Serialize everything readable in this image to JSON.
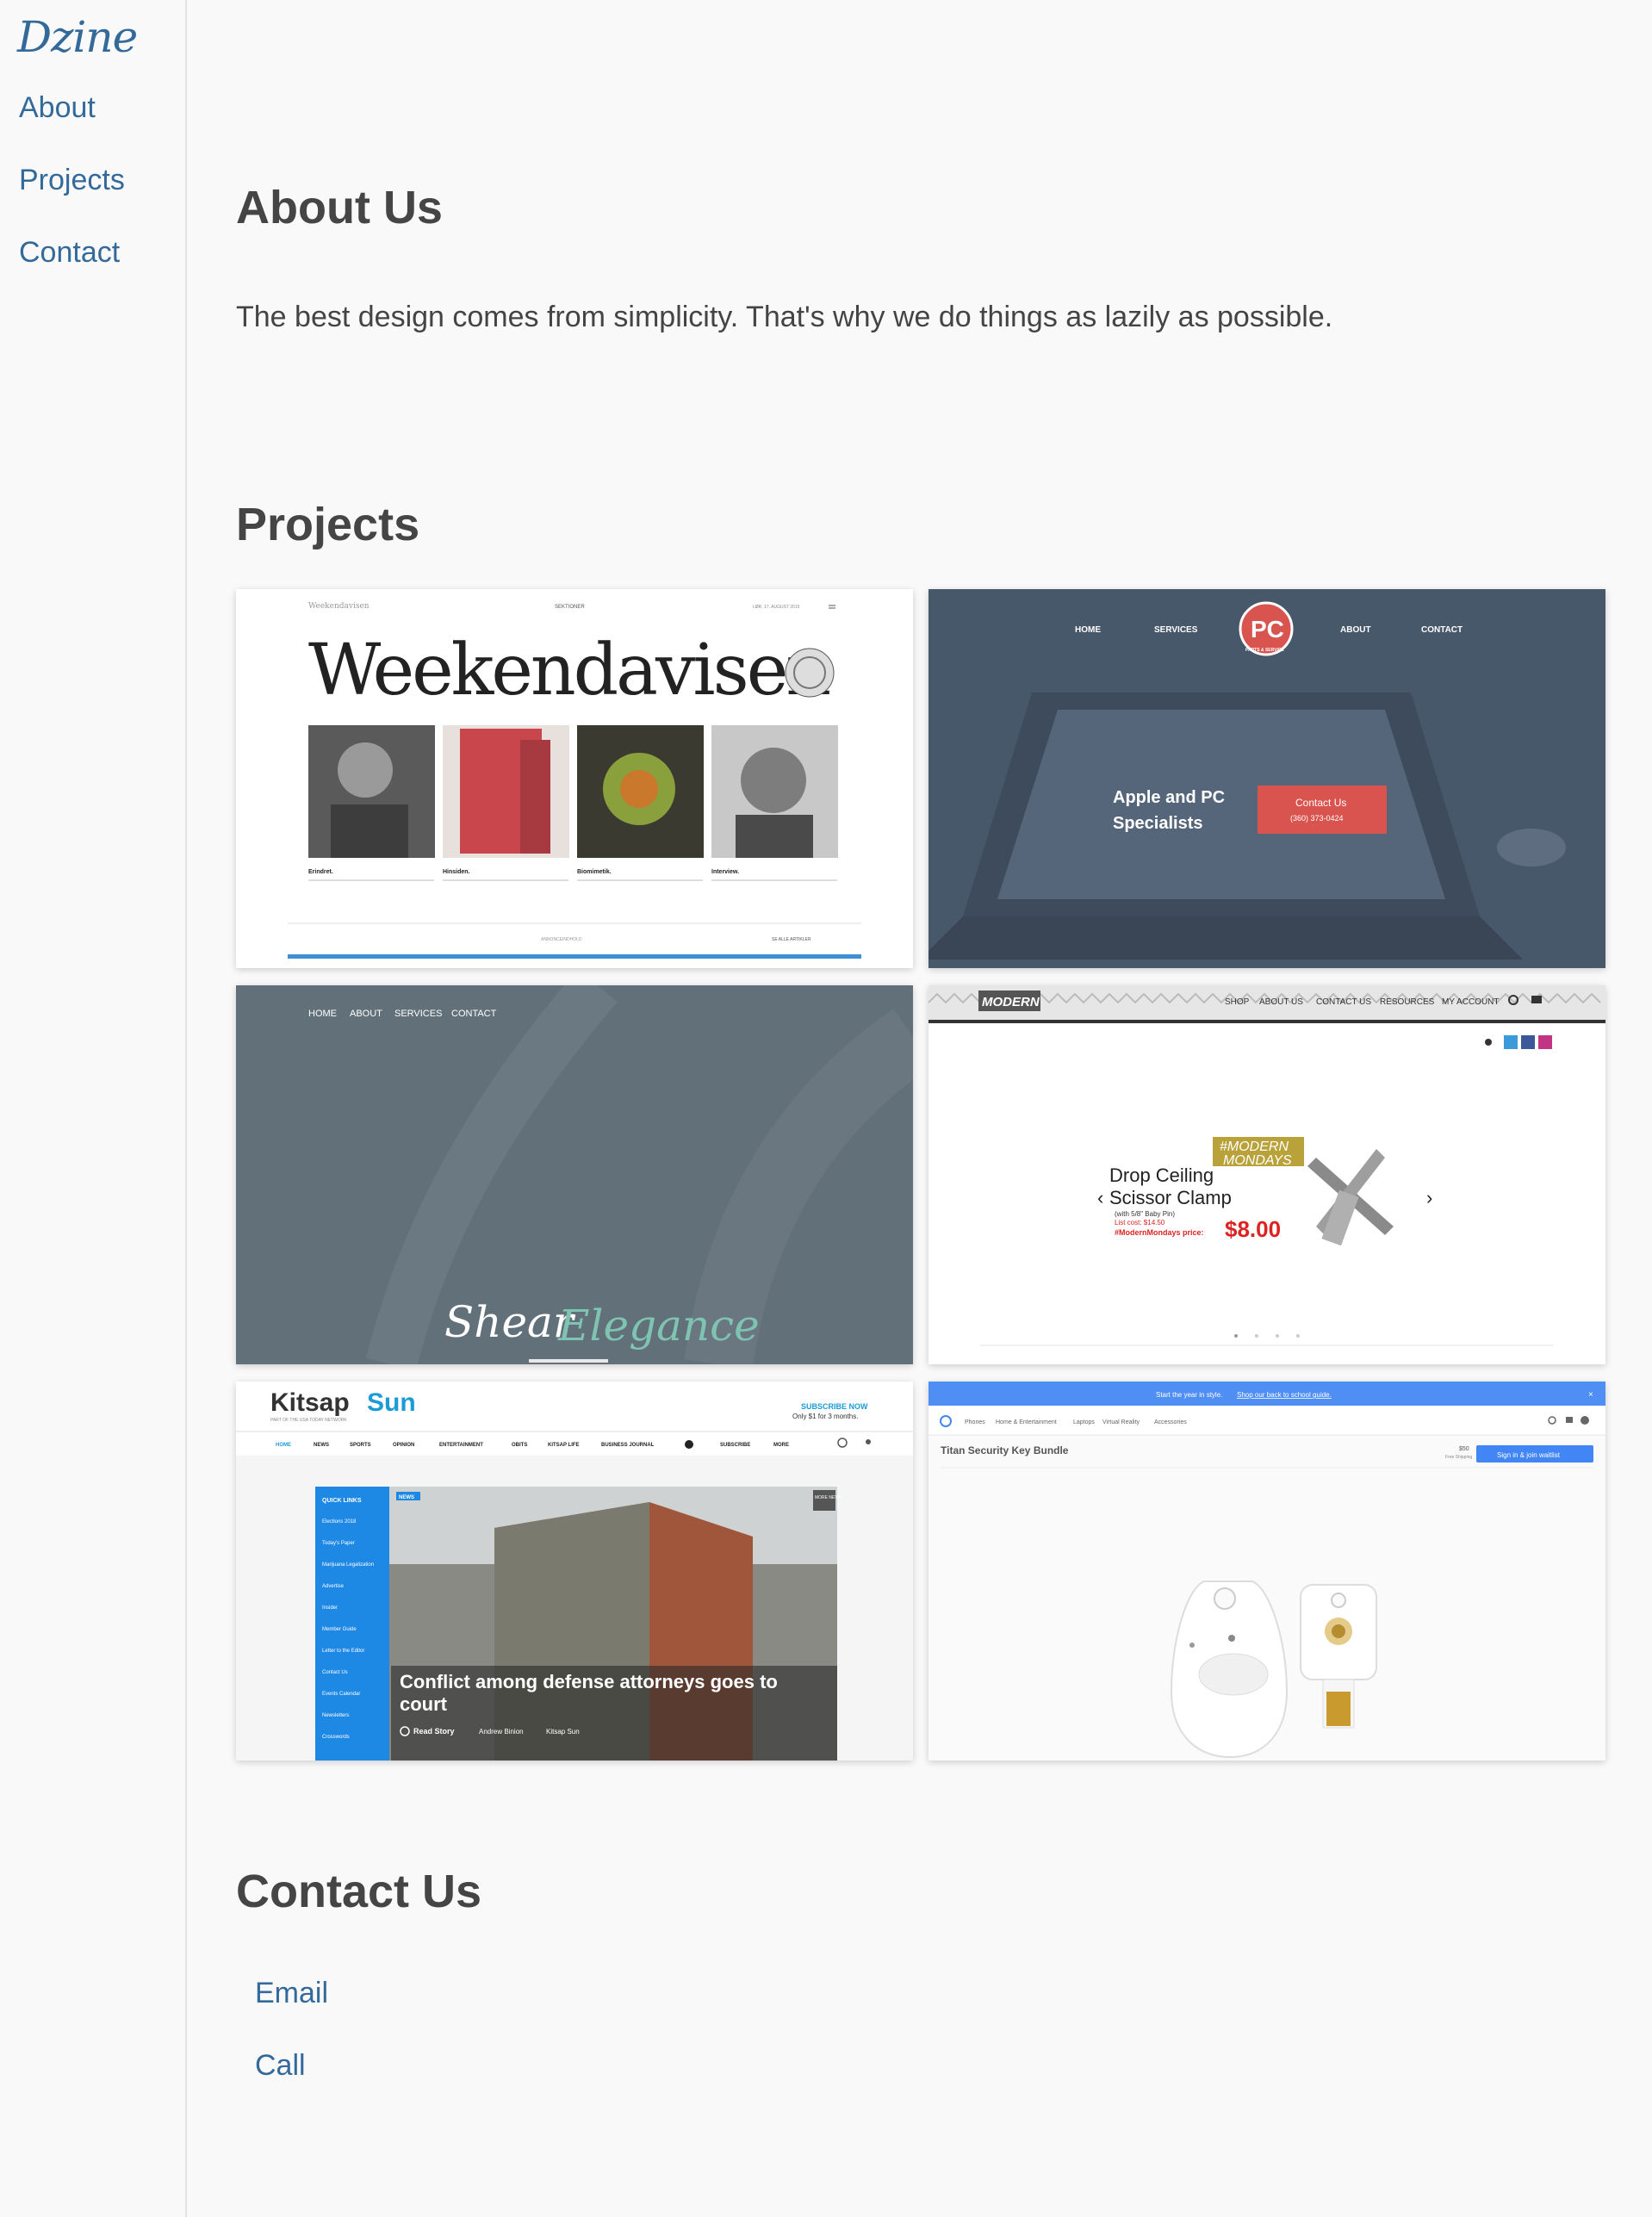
{
  "sidebar": {
    "logo": "Dzine",
    "nav": [
      "About",
      "Projects",
      "Contact"
    ]
  },
  "about": {
    "heading": "About Us",
    "text": "The best design comes from simplicity. That's why we do things as lazily as possible."
  },
  "projects": {
    "heading": "Projects",
    "items": [
      {
        "masthead": "Weekendavisen",
        "small_masthead": "Weekendavisen",
        "nav_center": "SEKTIONER",
        "nav_right": "LØR. 17. AUGUST 2019",
        "captions": [
          "Erindret.",
          "Hinsiden.",
          "Biomimetik.",
          "Interview."
        ],
        "footer_left": "ANNONCEINDHOLD",
        "footer_right": "SE ALLE ARTIKLER"
      },
      {
        "nav": [
          "HOME",
          "SERVICES",
          "ABOUT",
          "CONTACT"
        ],
        "logo_text": "PC",
        "logo_sub": "PARTS & SERVICE",
        "tagline_line1": "Apple and PC",
        "tagline_line2": "Specialists",
        "cta_line1": "Contact Us",
        "cta_line2": "(360) 373-0424"
      },
      {
        "nav": [
          "HOME",
          "ABOUT",
          "SERVICES",
          "CONTACT"
        ],
        "brand_part1": "Shear",
        "brand_part2": "Elegance"
      },
      {
        "logo": "MODERN",
        "nav": [
          "SHOP",
          "ABOUT US",
          "CONTACT US",
          "RESOURCES",
          "MY ACCOUNT"
        ],
        "badge_line1": "#MODERN",
        "badge_line2": "MONDAYS",
        "product_line1": "Drop Ceiling",
        "product_line2": "Scissor Clamp",
        "product_note": "(with 5/8\" Baby Pin)",
        "list_cost": "List cost: $14.50",
        "price_label": "#ModernMondays price:",
        "price": "$8.00"
      },
      {
        "brand_part1": "Kitsap",
        "brand_part2": "Sun",
        "tagline": "PART OF THE USA TODAY NETWORK",
        "subscribe": "SUBSCRIBE NOW",
        "subscribe_sub": "Only $1 for 3 months.",
        "nav": [
          "HOME",
          "NEWS",
          "SPORTS",
          "OPINION",
          "ENTERTAINMENT",
          "OBITS",
          "KITSAP LIFE",
          "BUSINESS JOURNAL",
          "SUBSCRIBE",
          "MORE"
        ],
        "quick_links_title": "QUICK LINKS",
        "quick_links": [
          "Elections 2018",
          "Today's Paper",
          "Marijuana Legalization",
          "Advertise",
          "Insider",
          "Member Guide",
          "Letter to the Editor",
          "Contact Us",
          "Events Calendar",
          "Newsletters",
          "Crosswords"
        ],
        "news_tag": "NEWS",
        "more_news": "MORE NEWS",
        "headline_line1": "Conflict among defense attorneys goes to",
        "headline_line2": "court",
        "read_story": "Read Story",
        "byline": "Andrew Binion",
        "source": "Kitsap Sun"
      },
      {
        "banner": "Start the year in style.",
        "banner_link": "Shop our back to school guide.",
        "nav": [
          "Phones",
          "Home & Entertainment",
          "Laptops",
          "Virtual Reality",
          "Accessories"
        ],
        "product": "Titan Security Key Bundle",
        "price": "$50",
        "shipping": "Free Shipping",
        "cta": "Sign in & join waitlist"
      }
    ]
  },
  "contact": {
    "heading": "Contact Us",
    "links": [
      "Email",
      "Call"
    ]
  },
  "colors": {
    "link": "#336a9a",
    "heading": "#454545",
    "background": "#f9f9f9"
  }
}
